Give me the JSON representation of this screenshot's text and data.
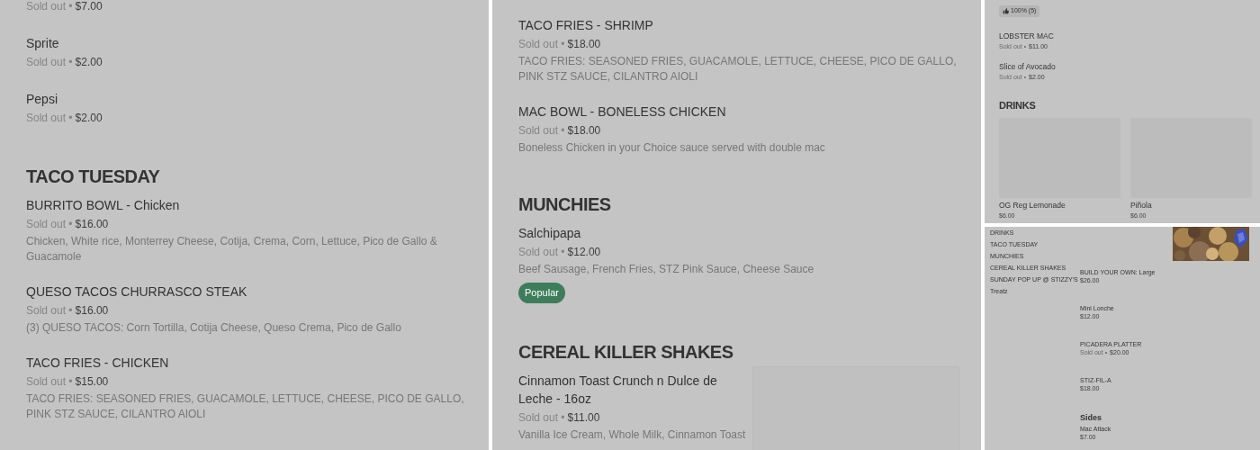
{
  "panels": [
    {
      "kind": "full",
      "entries": [
        {
          "kind": "item",
          "status": "Sold out •",
          "price": "$7.00"
        },
        {
          "kind": "item",
          "name": "Sprite",
          "status": "Sold out •",
          "price": "$2.00"
        },
        {
          "kind": "item",
          "name": "Pepsi",
          "status": "Sold out •",
          "price": "$2.00"
        },
        {
          "kind": "heading",
          "text": "TACO TUESDAY"
        },
        {
          "kind": "item",
          "name": "BURRITO BOWL - Chicken",
          "status": "Sold out •",
          "price": "$16.00",
          "description": "Chicken, White rice, Monterrey Cheese, Cotija, Crema, Corn, Lettuce, Pico de Gallo & Guacamole"
        },
        {
          "kind": "item",
          "name": "QUESO TACOS CHURRASCO STEAK",
          "status": "Sold out •",
          "price": "$16.00",
          "description": "(3) QUESO TACOS: Corn Tortilla, Cotija Cheese, Queso Crema, Pico de Gallo"
        },
        {
          "kind": "item",
          "name": "TACO FRIES - CHICKEN",
          "status": "Sold out •",
          "price": "$15.00",
          "description": "TACO FRIES: SEASONED FRIES, GUACAMOLE, LETTUCE, CHEESE, PICO DE GALLO, PINK STZ SAUCE, CILANTRO AIOLI"
        }
      ]
    },
    {
      "kind": "full",
      "entries": [
        {
          "kind": "item",
          "name": "TACO FRIES - SHRIMP",
          "status": "Sold out •",
          "price": "$18.00",
          "description": "TACO FRIES: SEASONED FRIES, GUACAMOLE, LETTUCE, CHEESE, PICO DE GALLO, PINK STZ SAUCE, CILANTRO AIOLI"
        },
        {
          "kind": "item",
          "name": "MAC BOWL - BONELESS CHICKEN",
          "status": "Sold out •",
          "price": "$18.00",
          "description": "Boneless Chicken in your Choice sauce served with double mac"
        },
        {
          "kind": "heading",
          "text": "MUNCHIES"
        },
        {
          "kind": "item",
          "name": "Salchipapa",
          "status": "Sold out •",
          "price": "$12.00",
          "description": "Beef Sausage, French Fries, STZ Pink Sauce, Cheese Sauce",
          "badge": {
            "kind": "popular",
            "text": "Popular"
          }
        },
        {
          "kind": "heading",
          "text": "CEREAL KILLER SHAKES"
        },
        {
          "kind": "item_with_image",
          "name": "Cinnamon Toast Crunch n Dulce de Leche - 16oz",
          "status": "Sold out •",
          "price": "$11.00",
          "description": "Vanilla Ice Cream, Whole Milk, Cinnamon Toast"
        }
      ]
    },
    {
      "kind": "compact",
      "entries": [
        {
          "kind": "item",
          "badge": {
            "kind": "rating",
            "text": "100% (5)"
          }
        },
        {
          "kind": "item",
          "name": "LOBSTER MAC",
          "status": "Sold out •",
          "price": "$11.00"
        },
        {
          "kind": "item",
          "name": "Slice of Avocado",
          "status": "Sold out •",
          "price": "$2.00"
        },
        {
          "kind": "heading",
          "text": "DRINKS"
        },
        {
          "kind": "cards",
          "items": [
            {
              "name": "OG Reg Lemonade",
              "price": "$6.00"
            },
            {
              "name": "Piñola",
              "price": "$6.00"
            }
          ]
        }
      ]
    },
    {
      "kind": "tiny",
      "sidebar": [
        "DRINKS",
        "TACO TUESDAY",
        "MUNCHIES",
        "CEREAL KILLER SHAKES",
        "SUNDAY POP UP @ STIZZY'S",
        "Treatz"
      ],
      "entries": [
        {
          "kind": "picture"
        },
        {
          "kind": "item",
          "name": "BUILD YOUR OWN: Large",
          "price": "$26.00"
        },
        {
          "kind": "item",
          "name": "Mini Lonche",
          "price": "$12.00"
        },
        {
          "kind": "item",
          "name": "PICADERA PLATTER",
          "status": "Sold out •",
          "price": "$20.00"
        },
        {
          "kind": "item",
          "name": "STIZ-FIL-A",
          "price": "$18.00"
        },
        {
          "kind": "heading",
          "text": "Sides"
        },
        {
          "kind": "item",
          "name": "Mac Attack",
          "price": "$7.00"
        }
      ]
    }
  ]
}
